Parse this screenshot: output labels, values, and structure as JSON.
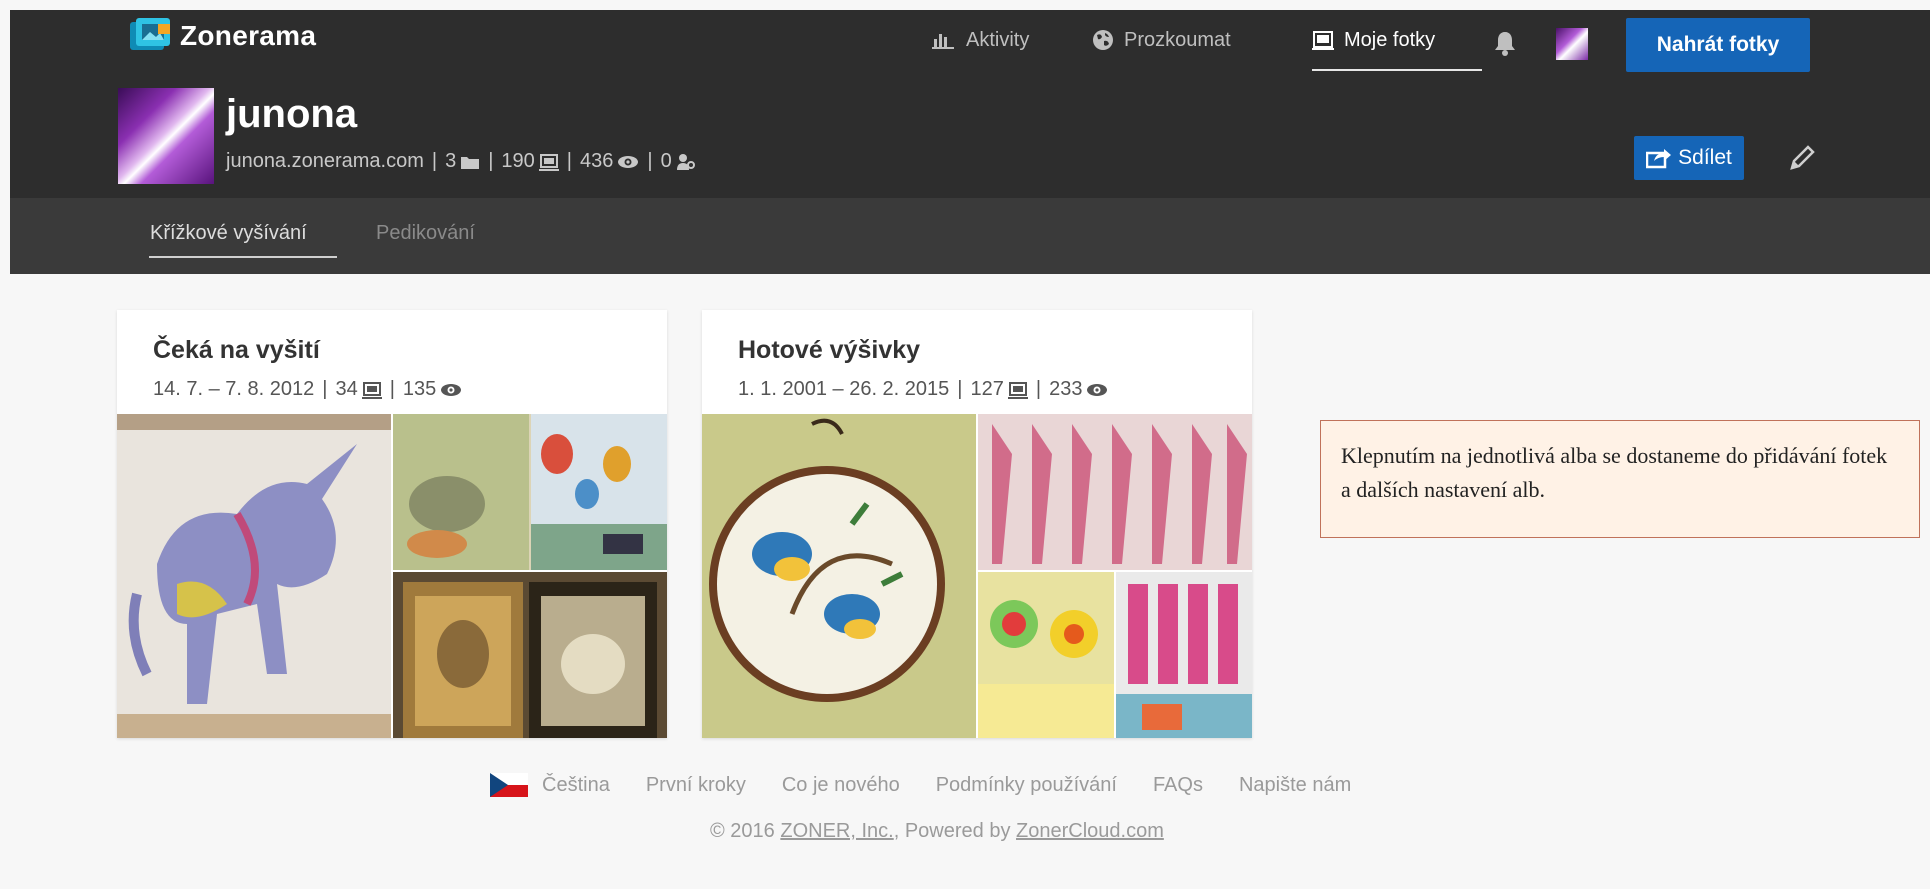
{
  "app": {
    "logo_text": "Zonerama"
  },
  "header": {
    "nav": [
      {
        "label": "Aktivity",
        "icon": "chart-icon"
      },
      {
        "label": "Prozkoumat",
        "icon": "globe-icon"
      },
      {
        "label": "Moje fotky",
        "icon": "photos-icon",
        "active": true
      }
    ],
    "upload_label": "Nahrát fotky",
    "accent_color": "#1565b7"
  },
  "profile": {
    "username": "junona",
    "url": "junona.zonerama.com",
    "albums_count": "3",
    "photos_count": "190",
    "views_count": "436",
    "followers_count": "0",
    "share_label": "Sdílet"
  },
  "tabs": [
    {
      "label": "Křížkové vyšívání",
      "active": true
    },
    {
      "label": "Pedikování",
      "active": false
    }
  ],
  "albums": [
    {
      "title": "Čeká na vyšití",
      "dates": "14. 7. – 7. 8. 2012",
      "photos": "34",
      "views": "135"
    },
    {
      "title": "Hotové výšivky",
      "dates": "1. 1. 2001 – 26. 2. 2015",
      "photos": "127",
      "views": "233"
    }
  ],
  "note": {
    "text": "Klepnutím na jednotlivá alba se dostaneme do přidávání fotek a dalších nastavení alb."
  },
  "footer": {
    "language": "Čeština",
    "links": [
      "První kroky",
      "Co je nového",
      "Podmínky používání",
      "FAQs",
      "Napište nám"
    ],
    "copyright_prefix": "© 2016",
    "company": "ZONER, Inc.",
    "powered_prefix": ", Powered by",
    "powered": "ZonerCloud.com"
  }
}
